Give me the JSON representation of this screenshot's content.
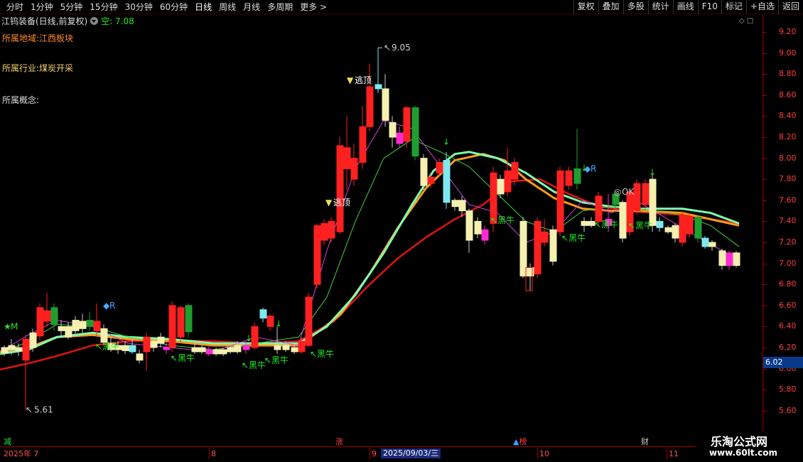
{
  "toolbar": {
    "periods": [
      "分时",
      "1分钟",
      "5分钟",
      "15分钟",
      "30分钟",
      "60分钟",
      "日线",
      "周线",
      "月线",
      "多周期",
      "更多 >"
    ],
    "active_period": "日线",
    "tools": [
      "复权",
      "叠加",
      "多股",
      "统计",
      "画线",
      "F10",
      "标记",
      "+自选",
      "返回"
    ]
  },
  "header": {
    "stock_title": "江钨装备(日线,前复权)",
    "signal_text": "空: 7.08"
  },
  "info": {
    "region_label": "所属地域:",
    "region_value": "江西板块",
    "industry_label": "所属行业:",
    "industry_value": "煤炭开采",
    "concept_label": "所属概念:",
    "concept_value": ""
  },
  "y_axis": {
    "ticks": [
      "9.20",
      "9.00",
      "8.80",
      "8.60",
      "8.40",
      "8.20",
      "8.00",
      "7.80",
      "7.60",
      "7.40",
      "7.20",
      "7.00",
      "6.80",
      "6.60",
      "6.40",
      "6.20",
      "6.00",
      "5.80",
      "5.60"
    ],
    "current_price": "6.02"
  },
  "x_axis": {
    "labels": [
      {
        "text": "2025年 7",
        "key": "jul"
      },
      {
        "text": "8",
        "key": "aug"
      },
      {
        "text": "9",
        "key": "sep"
      },
      {
        "text": "10",
        "key": "oct"
      },
      {
        "text": "11",
        "key": "nov"
      }
    ],
    "highlight_date": "2025/09/03/三"
  },
  "events": {
    "jian": "减",
    "zhang": "涨",
    "bang": "榜",
    "cai": "财"
  },
  "annotations": {
    "high_price": "9.05",
    "low_price": "5.61",
    "escape_top": "逃顶",
    "black_bull": "黑牛",
    "r_mark": "R",
    "m_mark": "M",
    "ok_mark": "OK"
  },
  "colors": {
    "up": "#ff2020",
    "down_fill": "#f5f0b0",
    "magenta": "#ff2ad4",
    "cyan": "#7ee8f0",
    "green_bar": "#1f9d2f",
    "ma_cyan": "#7effb0",
    "ma_red": "#e01414",
    "ma_orange": "#ff9a1a",
    "ma_magenta": "#d040e0",
    "ma_green": "#40d040",
    "signal_green": "#26e626"
  },
  "watermark": {
    "line1": "乐淘公式网",
    "line2": "www.60lt.com"
  }
}
